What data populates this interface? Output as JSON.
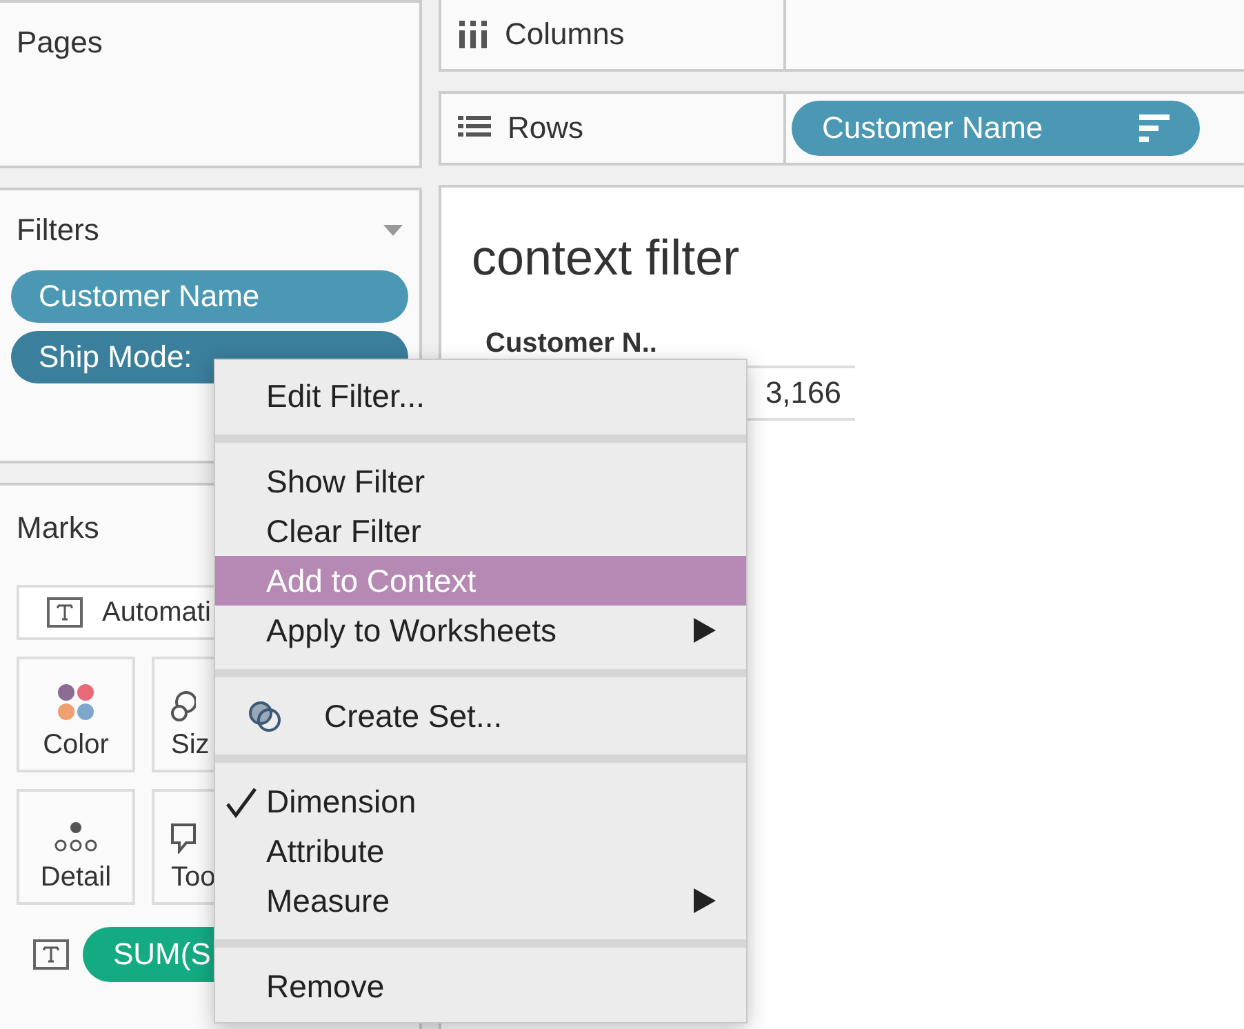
{
  "pages_panel": {
    "title": "Pages"
  },
  "filters_panel": {
    "title": "Filters",
    "pills": [
      {
        "label": "Customer Name",
        "selected": false
      },
      {
        "label": "Ship Mode:",
        "selected": true
      }
    ]
  },
  "marks_panel": {
    "title": "Marks",
    "mark_type": "Automati",
    "cards": [
      {
        "label": "Color",
        "kind": "color"
      },
      {
        "label": "Siz",
        "kind": "size"
      },
      {
        "label": "Detail",
        "kind": "detail"
      },
      {
        "label": "Too",
        "kind": "tooltip"
      }
    ],
    "fields": [
      {
        "kind": "text",
        "pill": "SUM(S"
      }
    ]
  },
  "shelves": [
    {
      "label": "Columns",
      "kind": "columns"
    },
    {
      "label": "Rows",
      "kind": "rows",
      "pills": [
        {
          "label": "Customer Name",
          "sorted": true
        }
      ]
    }
  ],
  "view": {
    "title": "context filter",
    "column_header": "Customer N..",
    "cell": "3,166"
  },
  "context_menu": {
    "items": [
      {
        "kind": "item",
        "label": "Edit Filter...",
        "selected": false
      },
      {
        "kind": "separator"
      },
      {
        "kind": "item",
        "label": "Show Filter",
        "selected": false
      },
      {
        "kind": "item",
        "label": "Clear Filter",
        "selected": false
      },
      {
        "kind": "item",
        "label": "Add to Context",
        "selected": true
      },
      {
        "kind": "item",
        "label": "Apply to Worksheets",
        "selected": false,
        "submenu": true
      },
      {
        "kind": "separator"
      },
      {
        "kind": "set_item",
        "label": "Create Set...",
        "selected": false
      },
      {
        "kind": "separator"
      },
      {
        "kind": "item",
        "label": "Dimension",
        "selected": false,
        "checked": true
      },
      {
        "kind": "item",
        "label": "Attribute",
        "selected": false,
        "checked": false
      },
      {
        "kind": "item",
        "label": "Measure",
        "selected": false,
        "checked": false,
        "submenu": true
      },
      {
        "kind": "separator"
      },
      {
        "kind": "item",
        "label": "Remove",
        "selected": false
      }
    ]
  }
}
